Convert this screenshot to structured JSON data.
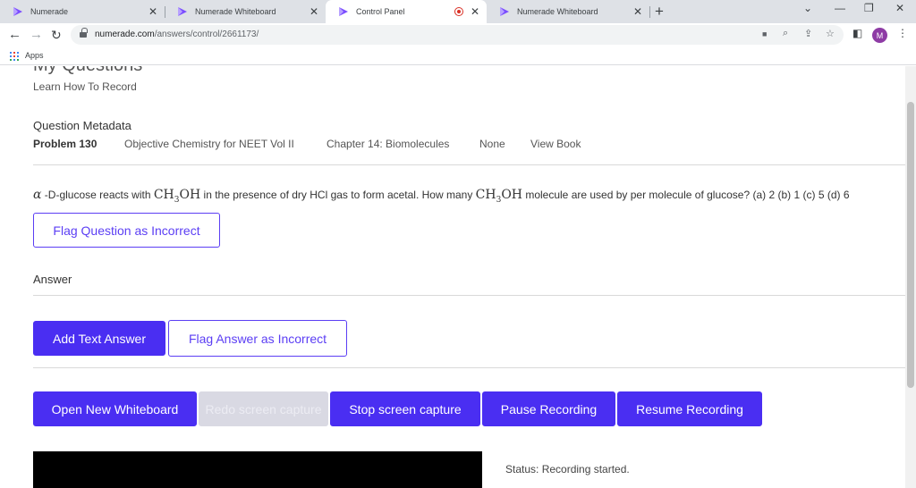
{
  "browser": {
    "tabs": [
      {
        "title": "Numerade",
        "active": false
      },
      {
        "title": "Numerade Whiteboard",
        "active": false
      },
      {
        "title": "Control Panel",
        "active": true,
        "recording": true
      },
      {
        "title": "Numerade Whiteboard",
        "active": false
      }
    ],
    "url": {
      "host": "numerade.com",
      "path": "/answers/control/2661173/"
    },
    "bookmarks": [
      {
        "label": "Apps"
      }
    ],
    "profile_initial": "M",
    "accent": "#8e3ba5"
  },
  "page": {
    "cut_title": "My Questions",
    "learn_link": "Learn How To Record",
    "metadata_heading": "Question Metadata",
    "metadata": {
      "problem": "Problem 130",
      "book": "Objective Chemistry for NEET Vol II",
      "chapter": "Chapter 14: Biomolecules",
      "section": "None",
      "view_book": "View Book"
    },
    "question": {
      "alpha": "α",
      "part1": " -D-glucose reacts with ",
      "formula_main": "CH",
      "formula_sub": "3",
      "formula_end": "OH",
      "part2": " in the presence of dry HCl gas to form acetal. How many ",
      "part3": " molecule are used by per molecule of glucose? (a) 2 (b) 1 (c) 5 (d) 6"
    },
    "flag_question_label": "Flag Question as Incorrect",
    "answer_heading": "Answer",
    "add_text_answer_label": "Add Text Answer",
    "flag_answer_label": "Flag Answer as Incorrect",
    "controls": {
      "open_whiteboard": "Open New Whiteboard",
      "redo_capture": "Redo screen capture",
      "stop_capture": "Stop screen capture",
      "pause_recording": "Pause Recording",
      "resume_recording": "Resume Recording"
    },
    "status": "Status: Recording started.",
    "colors": {
      "primary": "#4a2ef2",
      "outline": "#5b3ef4",
      "disabled": "#d9d9e3"
    }
  }
}
